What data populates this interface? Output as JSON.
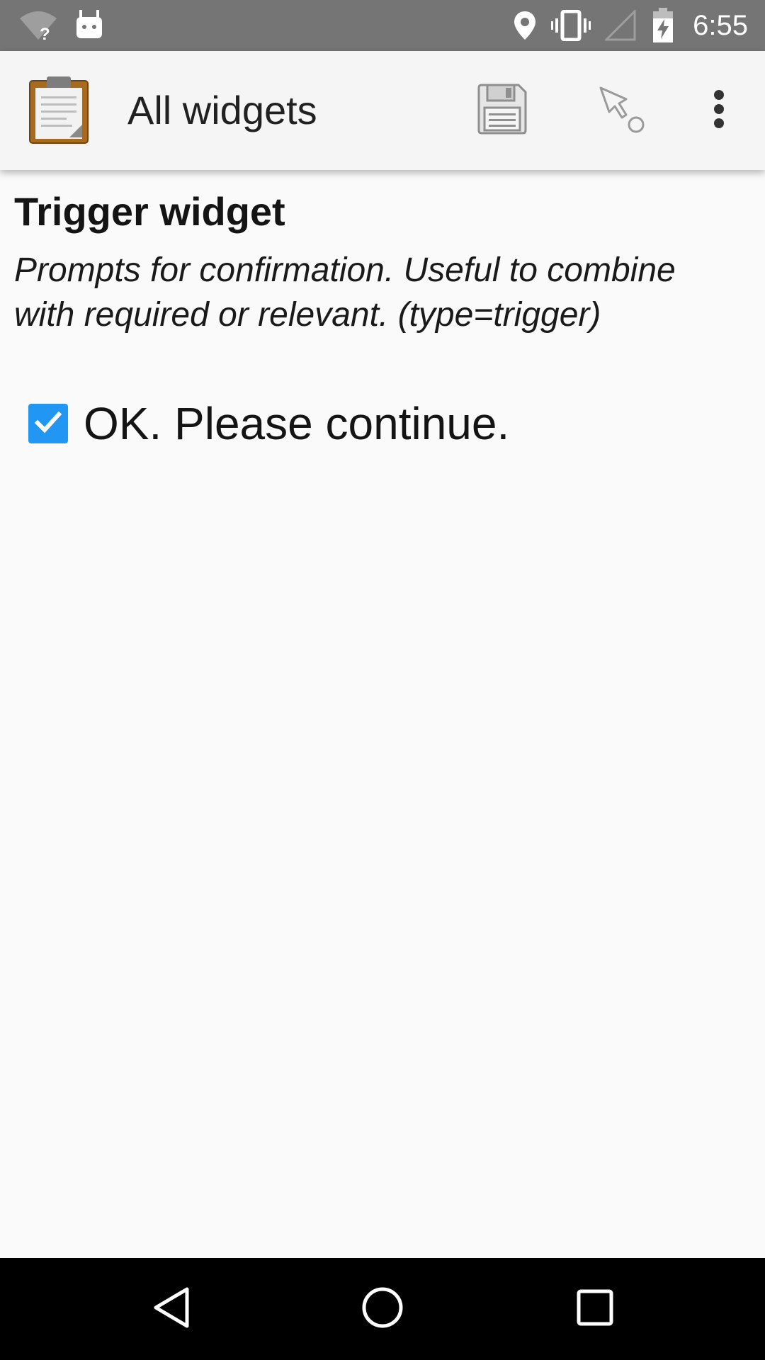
{
  "status_bar": {
    "time": "6:55",
    "icons": [
      "wifi-unknown-icon",
      "android-debug-icon",
      "location-icon",
      "vibrate-icon",
      "signal-icon",
      "battery-charging-icon"
    ]
  },
  "app_bar": {
    "title": "All widgets",
    "logo_icon": "clipboard-form-icon",
    "actions": [
      "save-icon",
      "goto-jump-icon",
      "overflow-menu-icon"
    ]
  },
  "question": {
    "label": "Trigger widget",
    "hint": "Prompts for confirmation. Useful to combine with required or relevant. (type=trigger)",
    "trigger_text": "OK. Please continue.",
    "checked": true
  },
  "colors": {
    "status_bar": "#757575",
    "app_bar": "#f5f5f5",
    "checkbox": "#2196f3",
    "nav_bar": "#000000"
  },
  "nav_bar": {
    "buttons": [
      "back-icon",
      "home-icon",
      "recents-icon"
    ]
  }
}
